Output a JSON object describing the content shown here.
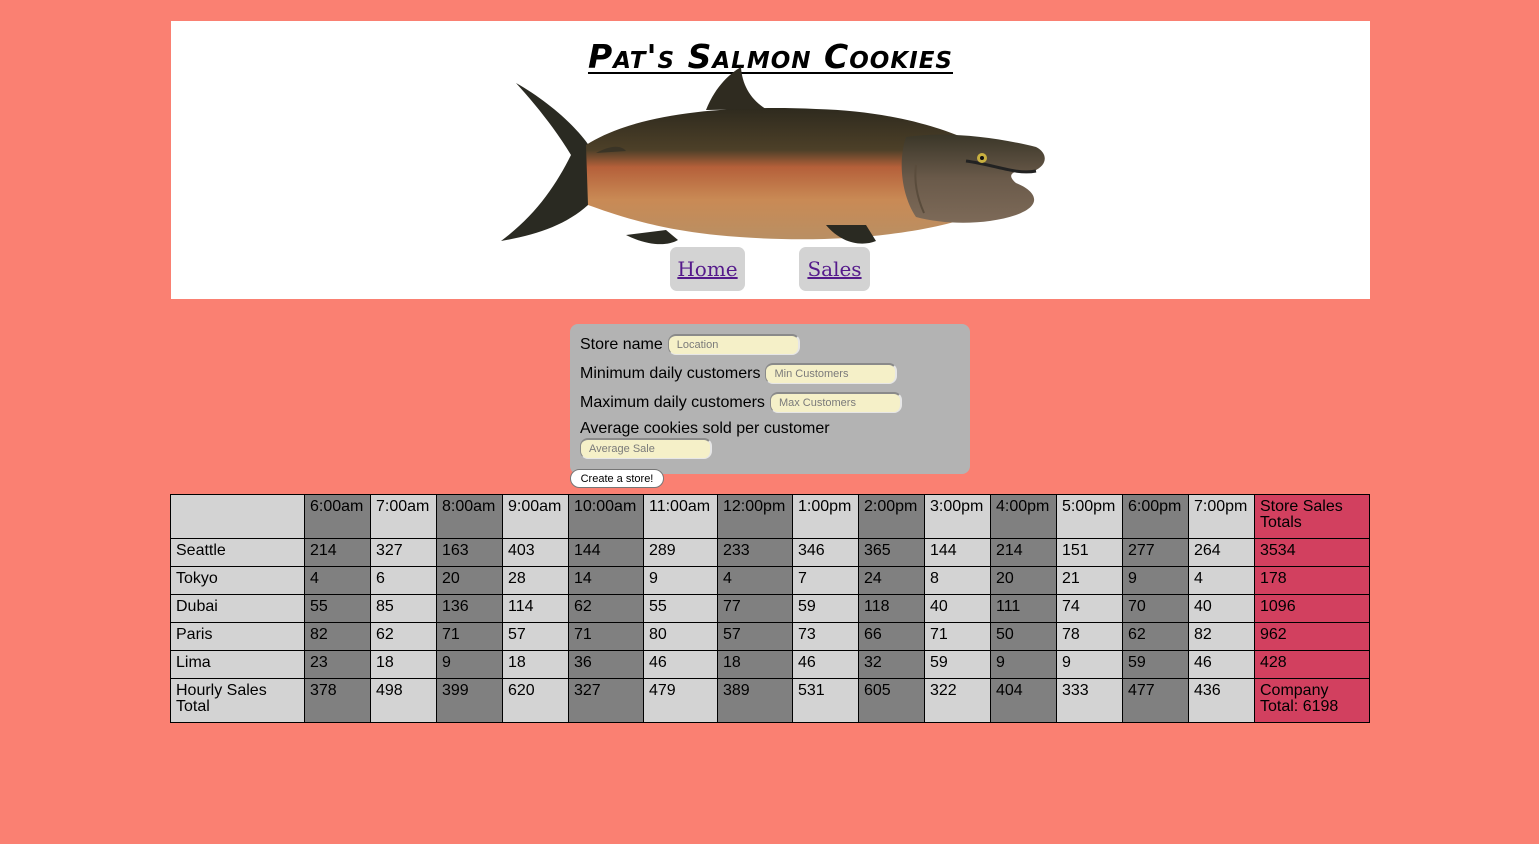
{
  "header": {
    "title": "Pat's Salmon Cookies",
    "image_alt": "salmon-fish",
    "nav": [
      {
        "label": "Home"
      },
      {
        "label": "Sales"
      }
    ]
  },
  "form": {
    "store_name_label": "Store name",
    "store_name_placeholder": "Location",
    "min_label": "Minimum daily customers",
    "min_placeholder": "Min Customers",
    "max_label": "Maximum daily customers",
    "max_placeholder": "Max Customers",
    "avg_label": "Average cookies sold per customer",
    "avg_placeholder": "Average Sale",
    "submit_label": "Create a store!"
  },
  "table": {
    "corner": "",
    "hours": [
      "6:00am",
      "7:00am",
      "8:00am",
      "9:00am",
      "10:00am",
      "11:00am",
      "12:00pm",
      "1:00pm",
      "2:00pm",
      "3:00pm",
      "4:00pm",
      "5:00pm",
      "6:00pm",
      "7:00pm"
    ],
    "totals_header": "Store Sales Totals",
    "rows": [
      {
        "name": "Seattle",
        "values": [
          214,
          327,
          163,
          403,
          144,
          289,
          233,
          346,
          365,
          144,
          214,
          151,
          277,
          264
        ],
        "total": "3534"
      },
      {
        "name": "Tokyo",
        "values": [
          4,
          6,
          20,
          28,
          14,
          9,
          4,
          7,
          24,
          8,
          20,
          21,
          9,
          4
        ],
        "total": "178"
      },
      {
        "name": "Dubai",
        "values": [
          55,
          85,
          136,
          114,
          62,
          55,
          77,
          59,
          118,
          40,
          111,
          74,
          70,
          40
        ],
        "total": "1096"
      },
      {
        "name": "Paris",
        "values": [
          82,
          62,
          71,
          57,
          71,
          80,
          57,
          73,
          66,
          71,
          50,
          78,
          62,
          82
        ],
        "total": "962"
      },
      {
        "name": "Lima",
        "values": [
          23,
          18,
          9,
          18,
          36,
          46,
          18,
          46,
          32,
          59,
          9,
          9,
          59,
          46
        ],
        "total": "428"
      }
    ],
    "footer": {
      "label": "Hourly Sales Total",
      "values": [
        378,
        498,
        399,
        620,
        327,
        479,
        389,
        531,
        605,
        322,
        404,
        333,
        477,
        436
      ],
      "total": "Company Total: 6198"
    }
  },
  "colors": {
    "background": "#fa8072",
    "dark_cell": "#808080",
    "light_cell": "#d3d3d3",
    "total_cell": "#d2405f"
  }
}
